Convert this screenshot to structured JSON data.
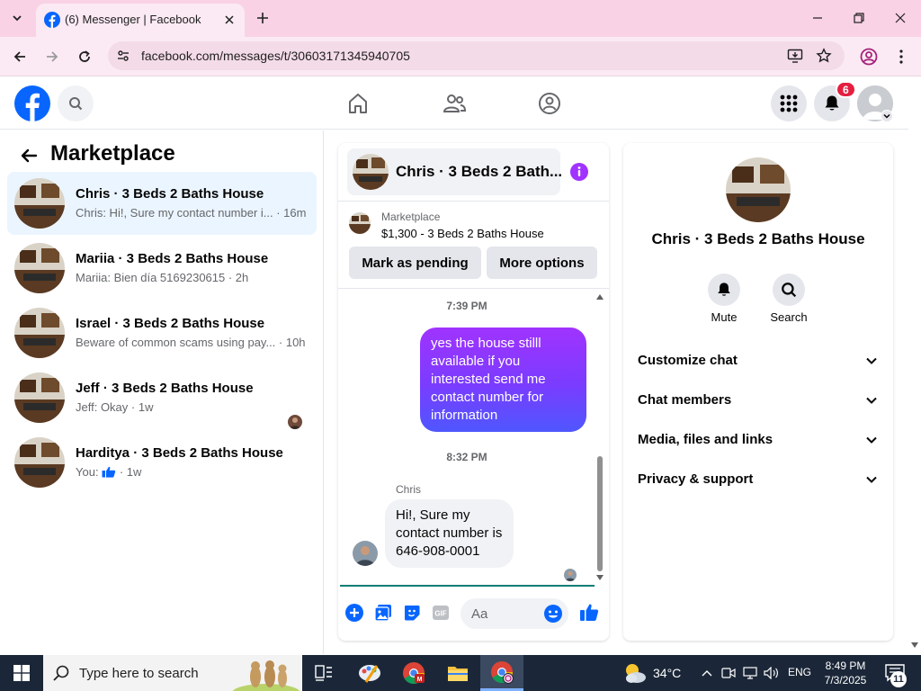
{
  "browser": {
    "tab_title": "(6) Messenger | Facebook",
    "url": "facebook.com/messages/t/30603171345940705"
  },
  "fb_header": {
    "notification_count": "6"
  },
  "sidebar": {
    "title": "Marketplace",
    "chats": [
      {
        "name": "Chris · 3 Beds 2 Baths House",
        "preview": "Chris: Hi!, Sure my contact number i... · 16m",
        "active": true
      },
      {
        "name": "Mariia · 3 Beds 2 Baths House",
        "preview": "Mariia: Bien día 5169230615 · 2h",
        "active": false
      },
      {
        "name": "Israel · 3 Beds 2 Baths House",
        "preview": "Beware of common scams using pay... · 10h",
        "active": false
      },
      {
        "name": "Jeff · 3 Beds 2 Baths House",
        "preview": "Jeff: Okay · 1w",
        "active": false
      },
      {
        "name": "Harditya · 3 Beds 2 Baths House",
        "preview_prefix": "You:",
        "preview_suffix": "· 1w",
        "active": false
      }
    ]
  },
  "conversation": {
    "header_name": "Chris · 3 Beds 2 Bath...",
    "listing_category": "Marketplace",
    "listing_price": "$1,300 - 3 Beds 2 Baths House",
    "mark_pending_label": "Mark as pending",
    "more_options_label": "More options",
    "messages": [
      {
        "time": "7:39 PM",
        "text": "yes the house stilll available if you interested send me contact number for information",
        "direction": "outgoing"
      },
      {
        "time": "8:32 PM",
        "sender": "Chris",
        "text": "Hi!, Sure my contact number is 646-908-0001",
        "direction": "incoming"
      }
    ],
    "composer_placeholder": "Aa"
  },
  "info_panel": {
    "name": "Chris · 3 Beds 2 Baths House",
    "mute_label": "Mute",
    "search_label": "Search",
    "sections": [
      "Customize chat",
      "Chat members",
      "Media, files and links",
      "Privacy & support"
    ]
  },
  "taskbar": {
    "search_placeholder": "Type here to search",
    "temperature": "34°C",
    "language": "ENG",
    "time": "8:49 PM",
    "date": "7/3/2025",
    "notification_count": "11"
  },
  "colors": {
    "facebook_blue": "#0866ff",
    "messenger_purple": "#a033ff",
    "active_chat_bg": "#ebf5ff",
    "chrome_tab_strip": "#f9d2e6"
  }
}
